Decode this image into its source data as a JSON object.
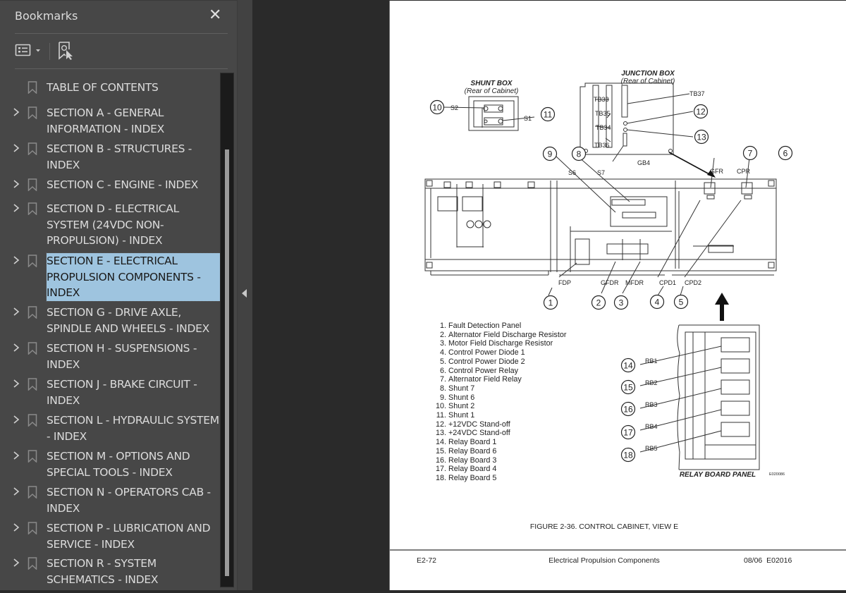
{
  "sidebar": {
    "title": "Bookmarks",
    "close_icon": "close-icon",
    "toolbar": {
      "options_icon": "list-options-icon",
      "find_icon": "find-current-bookmark-icon"
    },
    "items": [
      {
        "label": "TABLE OF CONTENTS",
        "expandable": false,
        "selected": false
      },
      {
        "label": "SECTION A - GENERAL INFORMATION - INDEX",
        "expandable": true,
        "selected": false
      },
      {
        "label": "SECTION B - STRUCTURES - INDEX",
        "expandable": true,
        "selected": false
      },
      {
        "label": "SECTION C - ENGINE - INDEX",
        "expandable": true,
        "selected": false
      },
      {
        "label": "SECTION D - ELECTRICAL SYSTEM (24VDC NON-PROPULSION) - INDEX",
        "expandable": true,
        "selected": false
      },
      {
        "label": "SECTION E - ELECTRICAL PROPULSION COMPONENTS - INDEX",
        "expandable": true,
        "selected": true
      },
      {
        "label": "SECTION G - DRIVE AXLE, SPINDLE AND WHEELS - INDEX",
        "expandable": true,
        "selected": false
      },
      {
        "label": "SECTION H - SUSPENSIONS - INDEX",
        "expandable": true,
        "selected": false
      },
      {
        "label": "SECTION J - BRAKE CIRCUIT - INDEX",
        "expandable": true,
        "selected": false
      },
      {
        "label": "SECTION L - HYDRAULIC SYSTEM - INDEX",
        "expandable": true,
        "selected": false
      },
      {
        "label": "SECTION M - OPTIONS AND SPECIAL TOOLS - INDEX",
        "expandable": true,
        "selected": false
      },
      {
        "label": "SECTION N - OPERATORS CAB - INDEX",
        "expandable": true,
        "selected": false
      },
      {
        "label": "SECTION P - LUBRICATION AND SERVICE - INDEX",
        "expandable": true,
        "selected": false
      },
      {
        "label": "SECTION R - SYSTEM SCHEMATICS - INDEX",
        "expandable": true,
        "selected": false
      }
    ],
    "selection_color": "#9ec4df"
  },
  "document": {
    "figure": {
      "shunt_box_title": "SHUNT BOX",
      "shunt_box_sub": "(Rear of Cabinet)",
      "junction_box_title": "JUNCTION BOX",
      "junction_box_sub": "(Rear of Cabinet)",
      "relay_panel_title": "RELAY BOARD PANEL",
      "image_code": "E020086",
      "caption": "FIGURE 2-36. CONTROL CABINET, VIEW E",
      "labels": {
        "s2": "S2",
        "s1": "S1",
        "tb33": "TB33",
        "tb35": "TB35",
        "tb34": "TB34",
        "tb36": "TB36",
        "tb37": "TB37",
        "gb4": "GB4",
        "s6": "S6",
        "s7": "S7",
        "gfr": "GFR",
        "cpr": "CPR",
        "fdp": "FDP",
        "gfdr": "GFDR",
        "mfdr": "MFDR",
        "cpd1": "CPD1",
        "cpd2": "CPD2",
        "rb1": "RB1",
        "rb2": "RB2",
        "rb3": "RB3",
        "rb4": "RB4",
        "rb5": "RB5"
      },
      "callouts": [
        "1",
        "2",
        "3",
        "4",
        "5",
        "6",
        "7",
        "8",
        "9",
        "10",
        "11",
        "12",
        "13",
        "14",
        "15",
        "16",
        "17",
        "18"
      ]
    },
    "legend": [
      {
        "n": "1.",
        "text": "Fault Detection Panel"
      },
      {
        "n": "2.",
        "text": "Alternator Field Discharge Resistor"
      },
      {
        "n": "3.",
        "text": "Motor Field Discharge Resistor"
      },
      {
        "n": "4.",
        "text": "Control Power Diode 1"
      },
      {
        "n": "5.",
        "text": "Control Power Diode 2"
      },
      {
        "n": "6.",
        "text": "Control Power Relay"
      },
      {
        "n": "7.",
        "text": "Alternator Field Relay"
      },
      {
        "n": "8.",
        "text": "Shunt 7"
      },
      {
        "n": "9.",
        "text": "Shunt 6"
      },
      {
        "n": "10.",
        "text": "Shunt 2"
      },
      {
        "n": "11.",
        "text": "Shunt 1"
      },
      {
        "n": "12.",
        "text": "+12VDC Stand-off"
      },
      {
        "n": "13.",
        "text": "+24VDC Stand-off"
      },
      {
        "n": "14.",
        "text": "Relay Board 1"
      },
      {
        "n": "15.",
        "text": "Relay Board 6"
      },
      {
        "n": "16.",
        "text": "Relay Board 3"
      },
      {
        "n": "17.",
        "text": "Relay Board 4"
      },
      {
        "n": "18.",
        "text": "Relay Board 5"
      }
    ],
    "footer": {
      "page": "E2-72",
      "section": "Electrical Propulsion Components",
      "date_code": "08/06  E02016"
    }
  }
}
